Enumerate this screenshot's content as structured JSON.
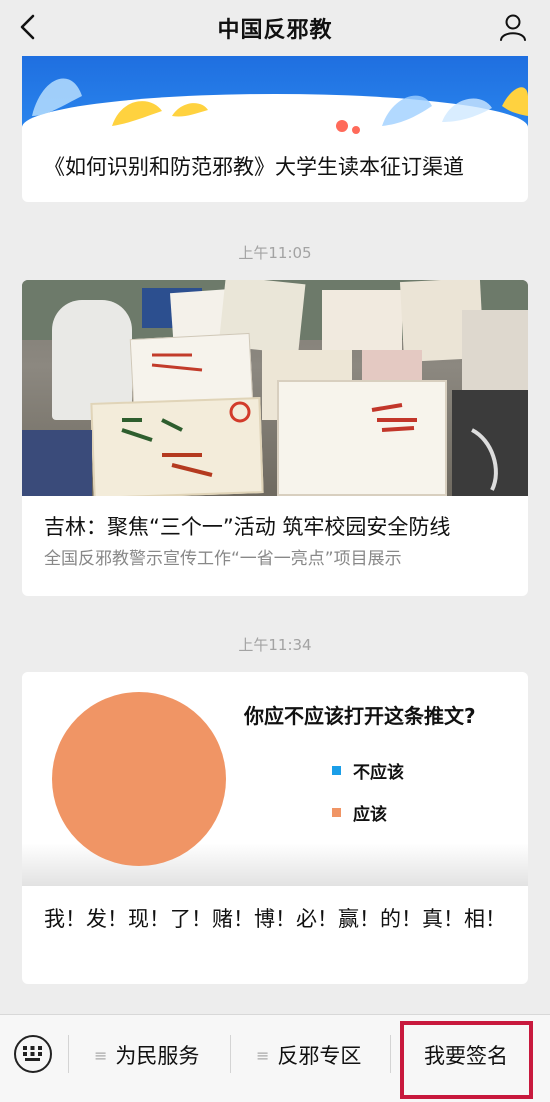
{
  "header": {
    "title": "中国反邪教"
  },
  "articles": [
    {
      "title": "《如何识别和防范邪教》大学生读本征订渠道"
    },
    {
      "timestamp": "上午11:05",
      "title": "吉林：聚焦“三个一”活动 筑牢校园安全防线",
      "subtitle": "全国反邪教警示宣传工作“一省一亮点”项目展示"
    },
    {
      "timestamp": "上午11:34",
      "title": "我！发！现！了！赌！博！必！赢！的！真！相！"
    }
  ],
  "chart_data": {
    "type": "pie",
    "title": "你应不应该打开这条推文?",
    "categories": [
      "不应该",
      "应该"
    ],
    "values": [
      0,
      100
    ],
    "colors": [
      "#1a9ee8",
      "#f09565"
    ],
    "legend": "right"
  },
  "bottom_menu": {
    "items": [
      "为民服务",
      "反邪专区",
      "我要签名"
    ]
  },
  "icons": {
    "back": "chevron-left-icon",
    "profile": "person-icon",
    "keyboard": "keyboard-icon",
    "menu": "menu-lines-icon"
  }
}
